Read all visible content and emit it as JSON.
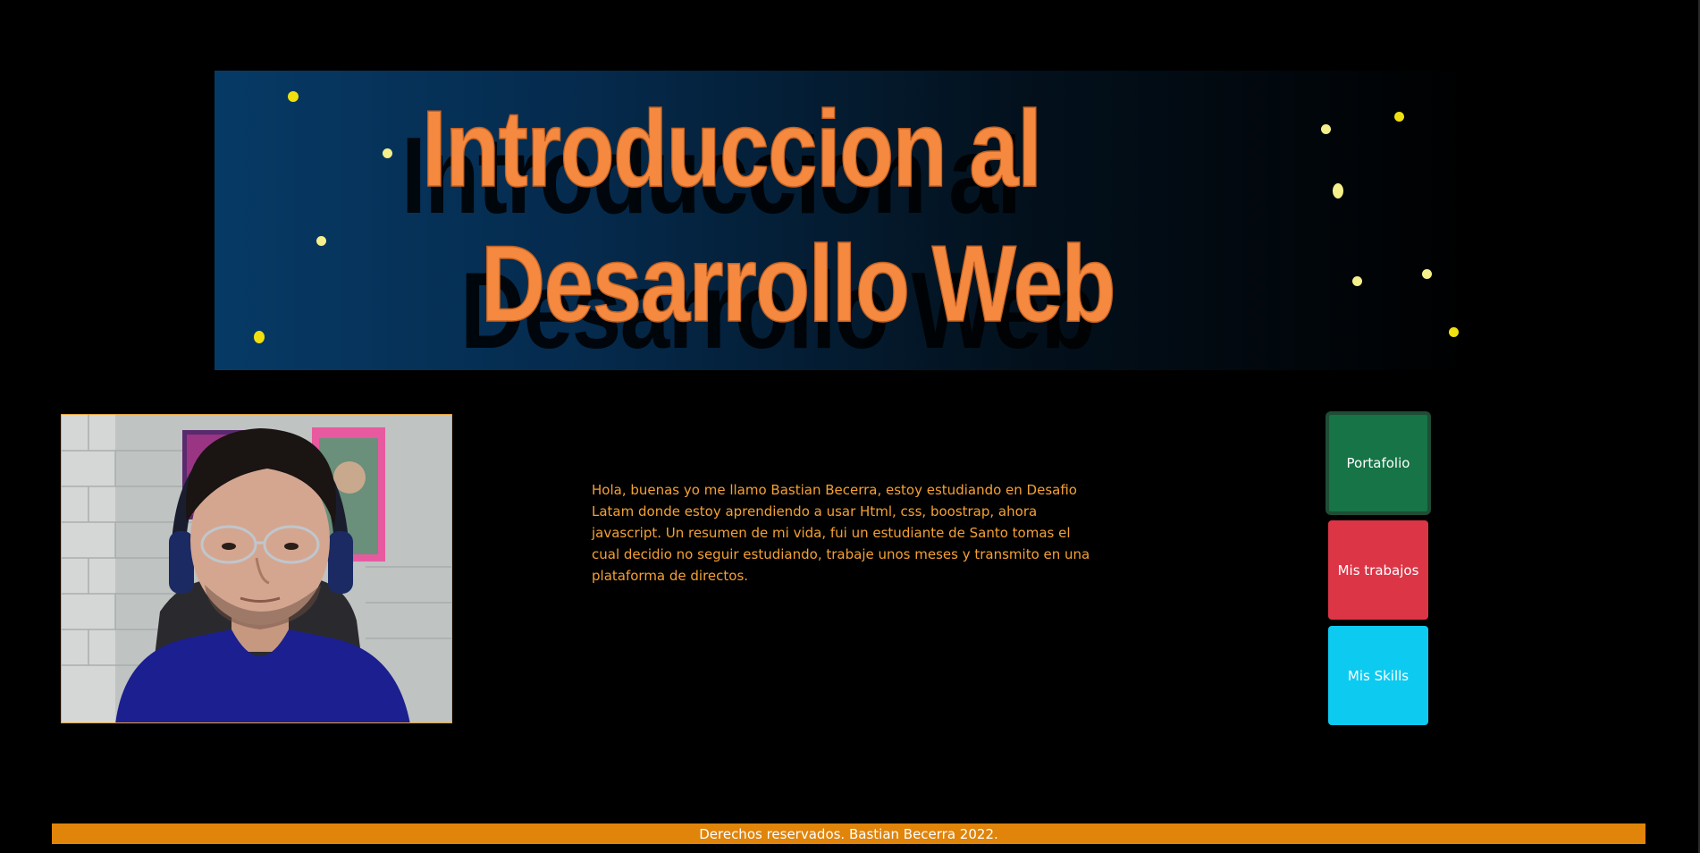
{
  "banner": {
    "title_line1": "Introduccion al",
    "title_line2": "Desarrollo Web",
    "title_color": "#f4893f",
    "gradient_start": "#063a66",
    "gradient_end": "#000000",
    "star_colors": [
      "#f0e010",
      "#f5ef8c"
    ]
  },
  "profile": {
    "photo_alt": "Foto de perfil",
    "border_color": "#e8a33c"
  },
  "bio": {
    "text": "Hola, buenas yo me llamo Bastian Becerra, estoy estudiando en Desafio Latam donde estoy aprendiendo a usar Html, css, boostrap, ahora javascript. Un resumen de mi vida, fui un estudiante de Santo tomas el cual decidio no seguir estudiando, trabaje unos meses y transmito en una plataforma de directos.",
    "color": "#f5a134"
  },
  "nav": {
    "portfolio_label": "Portafolio",
    "trabajos_label": "Mis trabajos",
    "skills_label": "Mis Skills",
    "portfolio_color": "#167446",
    "trabajos_color": "#dc3546",
    "skills_color": "#0dcaf0"
  },
  "footer": {
    "text": "Derechos reservados. Bastian Becerra 2022.",
    "background": "#e0840a"
  }
}
